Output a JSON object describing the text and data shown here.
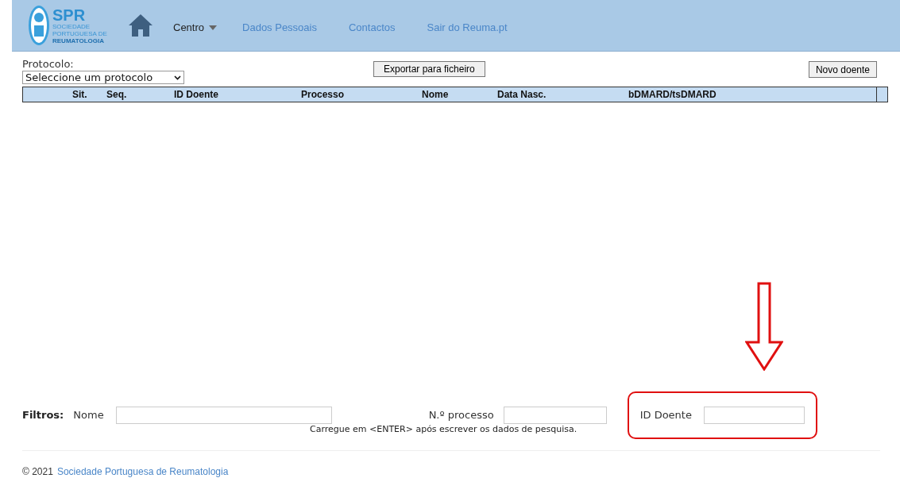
{
  "header": {
    "logo": {
      "text": "SPR",
      "subtitle": [
        "SOCIEDADE",
        "PORTUGUESA DE",
        "REUMATOLOGIA"
      ]
    },
    "nav": [
      {
        "label": "Centro",
        "kind": "dropdown"
      },
      {
        "label": "Dados Pessoais",
        "kind": "link"
      },
      {
        "label": "Contactos",
        "kind": "link"
      },
      {
        "label": "Sair do Reuma.pt",
        "kind": "link"
      }
    ]
  },
  "toolbar": {
    "protocol_label": "Protocolo:",
    "protocol_select": "Seleccione um protocolo",
    "export_button": "Exportar para ficheiro",
    "new_button": "Novo doente"
  },
  "table": {
    "columns": [
      "Sit.",
      "Seq.",
      "ID Doente",
      "Processo",
      "Nome",
      "Data Nasc.",
      "bDMARD/tsDMARD"
    ]
  },
  "filters": {
    "title": "Filtros:",
    "fields": [
      {
        "label": "Nome",
        "highlighted": false
      },
      {
        "label": "N.º processo",
        "highlighted": false
      },
      {
        "label": "ID Doente",
        "highlighted": true
      }
    ],
    "hint": "Carregue em <ENTER> após escrever os dados de pesquisa."
  },
  "footer": {
    "year": "© 2021",
    "link": "Sociedade Portuguesa de Reumatologia"
  }
}
